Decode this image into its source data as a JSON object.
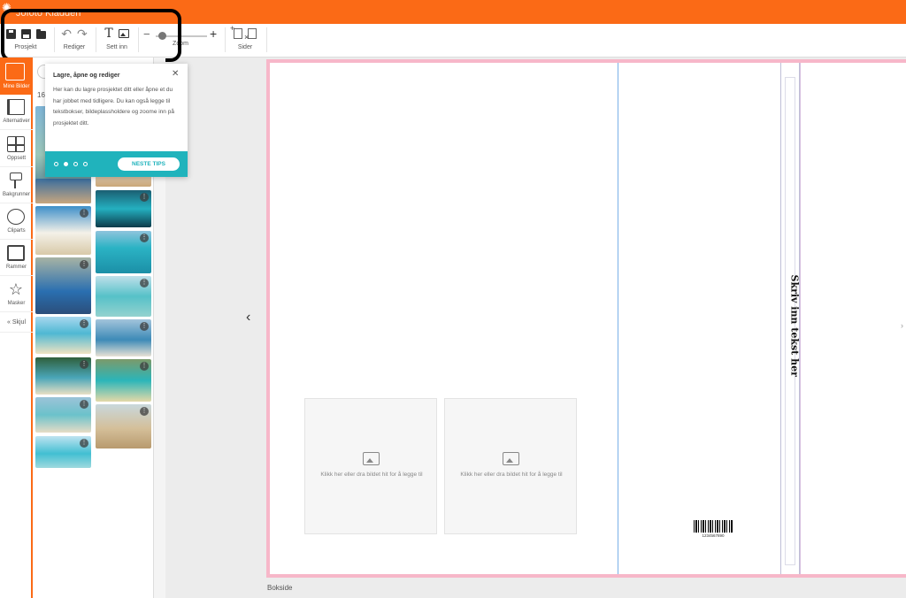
{
  "app": {
    "title": "Jofoto Kladden"
  },
  "toolbar": {
    "prosjekt_label": "Prosjekt",
    "rediger_label": "Rediger",
    "settinn_label": "Sett inn",
    "zoom_label": "Zoom",
    "sider_label": "Sider",
    "zoom_level": 0.08
  },
  "sidebar": {
    "items": [
      {
        "label": "Mine Bilder",
        "icon": "photos-icon",
        "active": true
      },
      {
        "label": "Alternativer",
        "icon": "book-icon"
      },
      {
        "label": "Oppsett",
        "icon": "layout-icon"
      },
      {
        "label": "Bakgrunner",
        "icon": "paint-roller-icon"
      },
      {
        "label": "Cliparts",
        "icon": "flower-icon"
      },
      {
        "label": "Rammer",
        "icon": "frame-icon"
      },
      {
        "label": "Masker",
        "icon": "star-icon"
      },
      {
        "label": "Skjul",
        "icon": "collapse-icon"
      }
    ]
  },
  "library": {
    "count": "16",
    "photos": [
      {
        "name": "beach-umbrella"
      },
      {
        "name": "turquoise-cove"
      },
      {
        "name": "cliff-bay"
      },
      {
        "name": "swimmer-blue-water"
      },
      {
        "name": "boat-on-shore"
      },
      {
        "name": "person-in-sea"
      },
      {
        "name": "coast-aerial"
      },
      {
        "name": "person-on-beach"
      },
      {
        "name": "crowded-beach"
      },
      {
        "name": "green-shore"
      },
      {
        "name": "long-boat"
      },
      {
        "name": "woman-on-sand"
      },
      {
        "name": "boat-turquoise"
      }
    ]
  },
  "tooltip": {
    "title": "Lagre, åpne og rediger",
    "body": "Her kan du lagre prosjektet ditt eller åpne et du har jobbet med tidligere. Du kan også legge til tekstbokser, bildeplassholdere og zoome inn på prosjektet ditt.",
    "next_label": "NESTE TIPS",
    "step": 2,
    "steps": 4
  },
  "canvas": {
    "placeholder_text": "Klikk her eller dra bildet hit for å legge til",
    "spine_text": "Skriv inn tekst her",
    "barcode_number": "1234567890",
    "page_label": "Bokside"
  },
  "colors": {
    "brand": "#fb6a16",
    "tip_footer": "#20b3bc",
    "bleed_border": "#f7b7c9"
  }
}
